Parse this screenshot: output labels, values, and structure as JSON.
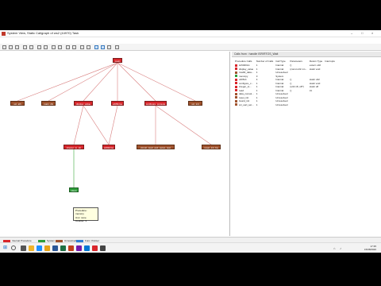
{
  "window": {
    "title": "System View, Static Callgraph of ws2 (44970) Task",
    "controls": [
      "–",
      "□",
      "×"
    ]
  },
  "menu": [
    "File",
    "View",
    "Display",
    "Configure",
    "Highlight",
    "Focus",
    "Window",
    "Help"
  ],
  "graph": {
    "root": "main",
    "level1": [
      "sci_alh",
      "main_clk",
      "display_value",
      "vd05cme",
      "configure_console",
      "sci_init"
    ],
    "level2": [
      "integer_to_str",
      "sd00cme",
      "circuit_read_and_setup_test",
      "reset_init_ba"
    ],
    "level3": [
      "sleep"
    ]
  },
  "tooltip": {
    "line1": "Procedure: memory",
    "line2": "Unc: none",
    "line3": "Counter: 3"
  },
  "panel": {
    "title": "Calls from : handle ISR/RTOS_Wait",
    "headers": [
      "Procedure Calls",
      "Number of Calls",
      "Call Type",
      "Parameters",
      "Return Type",
      "Interrupts"
    ],
    "rows": [
      {
        "color": "#d9262b",
        "name": "isr6400ctx",
        "calls": "1",
        "type": "Internal",
        "params": "()",
        "ret": "extern u32"
      },
      {
        "color": "#d9262b",
        "name": "display_value",
        "calls": "1",
        "type": "Internal",
        "params": "(const u32 mn...",
        "ret": "static void"
      },
      {
        "color": "#a0522d",
        "name": "rtos90_data...",
        "calls": "1",
        "type": "Unresolved",
        "params": "",
        "ret": ""
      },
      {
        "color": "#2e9e3a",
        "name": "memcpy",
        "calls": "3",
        "type": "System",
        "params": "",
        "ret": ""
      },
      {
        "color": "#d9262b",
        "name": "vd05cit",
        "calls": "4",
        "type": "Internal",
        "params": "()",
        "ret": "static u32"
      },
      {
        "color": "#d9262b",
        "name": "configure_c...",
        "calls": "1",
        "type": "Internal",
        "params": "()",
        "ret": "static void"
      },
      {
        "color": "#d9262b",
        "name": "integer_to...",
        "calls": "1",
        "type": "Internal",
        "params": "(u32 n8, u8*)",
        "ret": "static u8"
      },
      {
        "color": "#d9262b",
        "name": "read",
        "calls": "1",
        "type": "Internal",
        "params": "()",
        "ret": "int"
      },
      {
        "color": "#a0522d",
        "name": "data_consol...",
        "calls": "1",
        "type": "Unresolved",
        "params": "",
        "ret": ""
      },
      {
        "color": "#a0522d",
        "name": "reset_init",
        "calls": "1",
        "type": "Unresolved",
        "params": "",
        "ret": ""
      },
      {
        "color": "#a0522d",
        "name": "board_init",
        "calls": "1",
        "type": "Unresolved",
        "params": "",
        "ret": ""
      },
      {
        "color": "#a0522d",
        "name": "sci_uart_set...",
        "calls": "1",
        "type": "Unresolved",
        "params": "",
        "ret": ""
      }
    ]
  },
  "legend": [
    {
      "label": "Internal Procedure",
      "color": "#d9262b"
    },
    {
      "label": "System",
      "color": "#2e9e3a"
    },
    {
      "label": "Unresolved",
      "color": "#a0522d"
    },
    {
      "label": "Func. Pointer",
      "color": "#2f7fd6"
    }
  ],
  "taskbar": {
    "time": "17:35",
    "date": "15/08/2020"
  }
}
